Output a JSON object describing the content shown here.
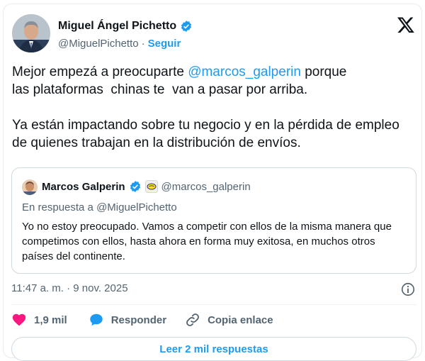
{
  "author": {
    "name": "Miguel Ángel Pichetto",
    "handle": "@MiguelPichetto",
    "separator": "·",
    "follow_label": "Seguir"
  },
  "tweet": {
    "line1_prefix": "Mejor empezá a preocuparte ",
    "mention": "@marcos_galperin",
    "line1_suffix": " porque",
    "line2": "las plataformas  chinas te  van a pasar por arriba.",
    "paragraph2": "Ya están impactando sobre tu negocio y en la pérdida de empleo de quienes trabajan en la distribución de envíos."
  },
  "quote": {
    "name": "Marcos Galperin",
    "handle": "@marcos_galperin",
    "reply_to": "En respuesta a @MiguelPichetto",
    "text": "Yo no estoy preocupado. Vamos a competir con ellos de la misma manera que competimos con ellos, hasta ahora en forma muy exitosa, en muchos otros países del continente."
  },
  "meta": {
    "timestamp": "11:47 a. m. · 9 nov. 2025"
  },
  "actions": {
    "likes": "1,9 mil",
    "reply_label": "Responder",
    "copy_label": "Copia enlace"
  },
  "footer": {
    "read_replies": "Leer 2 mil respuestas"
  },
  "colors": {
    "accent": "#1d9bf0",
    "like": "#f91880",
    "text": "#0f1419",
    "muted": "#536471"
  }
}
